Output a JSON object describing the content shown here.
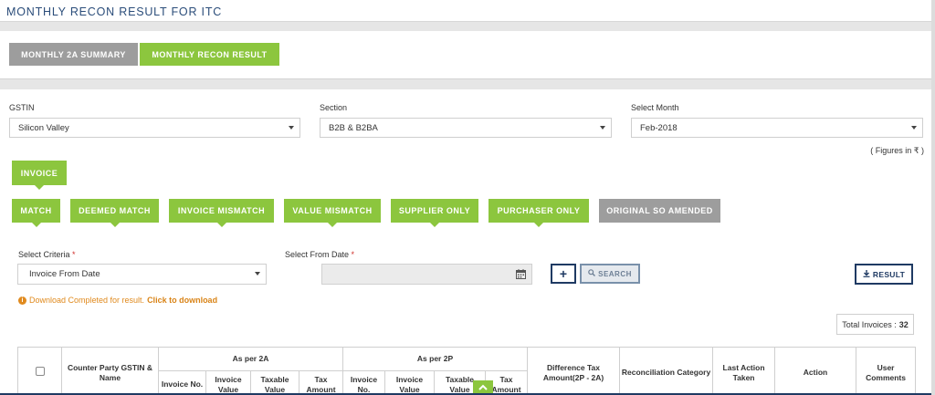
{
  "page_title": "MONTHLY RECON RESULT FOR ITC",
  "tabs": [
    {
      "label": "MONTHLY 2A SUMMARY",
      "active": false
    },
    {
      "label": "MONTHLY RECON RESULT",
      "active": true
    }
  ],
  "filters": {
    "gstin": {
      "label": "GSTIN",
      "value": "Silicon Valley"
    },
    "section": {
      "label": "Section",
      "value": "B2B & B2BA"
    },
    "month": {
      "label": "Select Month",
      "value": "Feb-2018"
    }
  },
  "figures_note": "( Figures in ₹ )",
  "invoice_button": "INVOICE",
  "category_buttons": [
    "MATCH",
    "DEEMED MATCH",
    "INVOICE MISMATCH",
    "VALUE MISMATCH",
    "SUPPLIER ONLY",
    "PURCHASER ONLY"
  ],
  "amended_button": "ORIGINAL SO AMENDED",
  "criteria": {
    "label": "Select Criteria",
    "required_mark": "*",
    "value": "Invoice From Date"
  },
  "from_date": {
    "label": "Select From Date",
    "required_mark": "*",
    "value": ""
  },
  "buttons": {
    "add": "+",
    "search": "SEARCH",
    "result": "RESULT"
  },
  "download_message": {
    "text": "Download Completed for result.",
    "link": "Click to download"
  },
  "total_invoices": {
    "label": "Total Invoices :",
    "value": "32"
  },
  "table": {
    "columns": {
      "counter_party": "Counter Party GSTIN & Name",
      "as_per_2a": "As per 2A",
      "as_per_2p": "As per 2P",
      "difference": "Difference Tax Amount(2P - 2A)",
      "recon_category": "Reconciliation Category",
      "last_action": "Last Action Taken",
      "action": "Action",
      "user_comments": "User Comments"
    },
    "sub_2a": [
      "Invoice No.",
      "Invoice Value",
      "Taxable Value",
      "Tax Amount"
    ],
    "sub_2p": [
      "Invoice No.",
      "Invoice Value",
      "Taxable Value",
      "Tax Amount"
    ]
  },
  "colors": {
    "green": "#8cc63e",
    "grey": "#9d9d9d",
    "navy": "#1f3a63",
    "orange": "#e08a1e"
  }
}
